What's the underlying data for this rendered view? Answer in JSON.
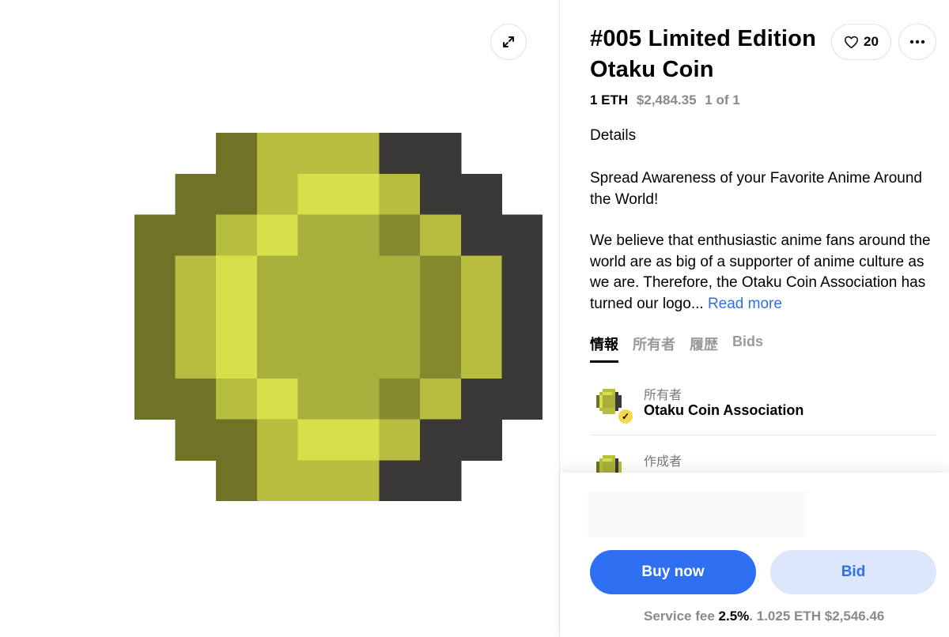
{
  "nft": {
    "title": "#005 Limited Edition Otaku Coin",
    "price_eth": "1 ETH",
    "price_usd": "$2,484.35",
    "edition": "1 of 1"
  },
  "actions": {
    "expand_icon": "expand-icon",
    "like_count": "20",
    "like_icon": "heart-icon",
    "more_icon": "more-horizontal-icon"
  },
  "details": {
    "label": "Details",
    "paragraph1": "Spread Awareness of your Favorite Anime Around the World!",
    "paragraph2": "We believe that enthusiastic anime fans around the world are as big of a supporter of anime culture as we are. Therefore, the Otaku Coin Association has turned our logo...",
    "read_more": "Read more"
  },
  "tabs": [
    {
      "label": "情報",
      "active": true
    },
    {
      "label": "所有者",
      "active": false
    },
    {
      "label": "履歴",
      "active": false
    },
    {
      "label": "Bids",
      "active": false
    }
  ],
  "people": {
    "owner": {
      "role": "所有者",
      "name": "Otaku Coin Association",
      "verified_icon": "check-icon"
    },
    "creator": {
      "role": "作成者"
    }
  },
  "purchase": {
    "buy_label": "Buy now",
    "bid_label": "Bid",
    "fee_label": "Service fee",
    "fee_percent": "2.5%",
    "fee_sep": ".",
    "total_eth": "1.025 ETH",
    "total_usd": "$2,546.46"
  },
  "colors": {
    "accent": "#2f6ff2",
    "bid_bg": "#dde7fb",
    "coin_outer_dark": "#6e7326",
    "coin_yellow": "#b6bd3f",
    "coin_highlight": "#d6e04a",
    "coin_face": "#a6b03a",
    "coin_shade": "#848a2e",
    "coin_shadow": "#3b3838"
  }
}
